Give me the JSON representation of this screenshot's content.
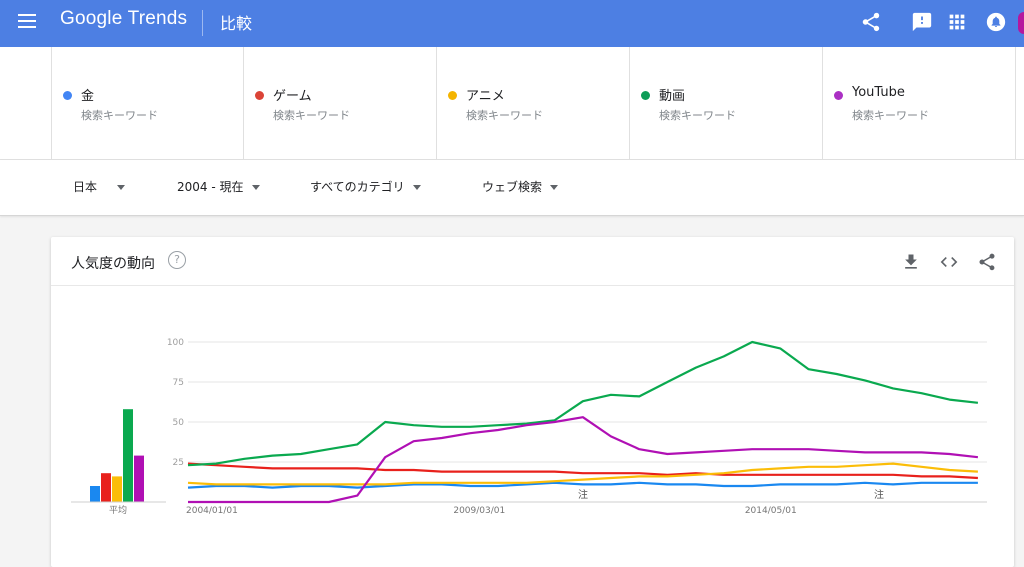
{
  "header": {
    "logo_google": "Google",
    "logo_trends": "Trends",
    "page_title": "比較",
    "icons": [
      "menu-icon",
      "share-icon",
      "feedback-icon",
      "apps-icon",
      "notifications-icon"
    ]
  },
  "terms": [
    {
      "name": "金",
      "subtitle": "検索キーワード",
      "color": "#4285f4"
    },
    {
      "name": "ゲーム",
      "subtitle": "検索キーワード",
      "color": "#db4437"
    },
    {
      "name": "アニメ",
      "subtitle": "検索キーワード",
      "color": "#f4b400"
    },
    {
      "name": "動画",
      "subtitle": "検索キーワード",
      "color": "#0f9d58"
    },
    {
      "name": "YouTube",
      "subtitle": "検索キーワード",
      "color": "#ab30c4"
    }
  ],
  "filters": {
    "region": "日本",
    "period": "2004 - 現在",
    "category": "すべてのカテゴリ",
    "search_type": "ウェブ検索"
  },
  "card": {
    "title": "人気度の動向",
    "help_symbol": "?",
    "icons": [
      "download-icon",
      "embed-icon",
      "share-icon"
    ]
  },
  "chart_data": {
    "type": "line",
    "x_tick_labels": [
      "2004/01/01",
      "2009/03/01",
      "2014/05/01"
    ],
    "y_tick_labels": [
      "25",
      "50",
      "75",
      "100"
    ],
    "ylim": [
      0,
      100
    ],
    "grid": true,
    "annotations": [
      {
        "label": "注",
        "x": "2011-01"
      },
      {
        "label": "注",
        "x": "2016-04"
      }
    ],
    "average_label": "平均",
    "averages": [
      {
        "term": "金",
        "value": 10
      },
      {
        "term": "ゲーム",
        "value": 18
      },
      {
        "term": "アニメ",
        "value": 16
      },
      {
        "term": "動画",
        "value": 58
      },
      {
        "term": "YouTube",
        "value": 29
      }
    ],
    "x_dates": [
      "2004-01",
      "2004-07",
      "2005-01",
      "2005-07",
      "2006-01",
      "2006-07",
      "2007-01",
      "2007-07",
      "2008-01",
      "2008-07",
      "2009-01",
      "2009-07",
      "2010-01",
      "2010-07",
      "2011-01",
      "2011-07",
      "2012-01",
      "2012-07",
      "2013-01",
      "2013-07",
      "2014-01",
      "2014-07",
      "2015-01",
      "2015-07",
      "2016-01",
      "2016-07",
      "2017-01",
      "2017-07",
      "2018-01"
    ],
    "series": [
      {
        "name": "金",
        "color": "#1a88f0",
        "values": [
          9,
          10,
          10,
          9,
          10,
          10,
          9,
          10,
          11,
          11,
          10,
          10,
          11,
          12,
          11,
          11,
          12,
          11,
          11,
          10,
          10,
          11,
          11,
          11,
          12,
          11,
          12,
          12,
          12
        ]
      },
      {
        "name": "ゲーム",
        "color": "#e8211c",
        "values": [
          24,
          23,
          22,
          21,
          21,
          21,
          21,
          20,
          20,
          19,
          19,
          19,
          19,
          19,
          18,
          18,
          18,
          17,
          18,
          17,
          17,
          17,
          17,
          17,
          17,
          17,
          16,
          16,
          15
        ]
      },
      {
        "name": "アニメ",
        "color": "#fbbd08",
        "values": [
          12,
          11,
          11,
          11,
          11,
          11,
          11,
          11,
          12,
          12,
          12,
          12,
          12,
          13,
          14,
          15,
          16,
          16,
          17,
          18,
          20,
          21,
          22,
          22,
          23,
          24,
          22,
          20,
          19
        ]
      },
      {
        "name": "動画",
        "color": "#0aa94f",
        "values": [
          23,
          24,
          27,
          29,
          30,
          33,
          36,
          50,
          48,
          47,
          47,
          48,
          49,
          51,
          63,
          67,
          66,
          75,
          84,
          91,
          100,
          96,
          83,
          80,
          76,
          71,
          68,
          64,
          62
        ]
      },
      {
        "name": "YouTube",
        "color": "#b010b4",
        "values": [
          0,
          0,
          0,
          0,
          0,
          0,
          4,
          28,
          38,
          40,
          43,
          45,
          48,
          50,
          53,
          41,
          33,
          30,
          31,
          32,
          33,
          33,
          33,
          32,
          31,
          31,
          31,
          30,
          28
        ]
      }
    ]
  }
}
